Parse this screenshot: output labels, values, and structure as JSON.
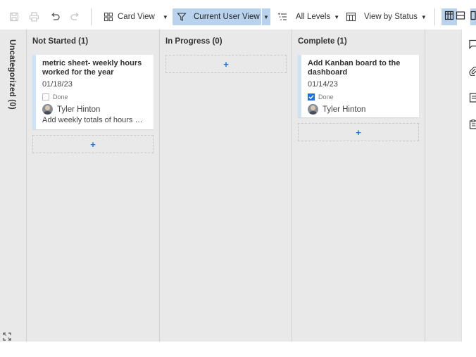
{
  "toolbar": {
    "card_view_label": "Card View",
    "current_user_view_label": "Current User View",
    "all_levels_label": "All Levels",
    "view_by_status_label": "View by Status",
    "accent_color": "#b9d3ee"
  },
  "sidebar": {
    "uncategorized_label": "Uncategorized (0)"
  },
  "columns": [
    {
      "title": "Not Started (1)",
      "cards": [
        {
          "title": "metric sheet- weekly hours worked for the year",
          "date": "01/18/23",
          "done_label": "Done",
          "done": false,
          "user": "Tyler Hinton",
          "description": "Add weekly totals of hours worked"
        }
      ],
      "add_label": "+"
    },
    {
      "title": "In Progress (0)",
      "cards": [],
      "add_label": "+"
    },
    {
      "title": "Complete (1)",
      "cards": [
        {
          "title": "Add Kanban board to the dashboard",
          "date": "01/14/23",
          "done_label": "Done",
          "done": true,
          "user": "Tyler Hinton"
        }
      ],
      "add_label": "+"
    }
  ],
  "colors": {
    "board_bg": "#e9e9e9",
    "card_stripe": "#cfe3f7",
    "add_plus": "#1a73e8"
  }
}
